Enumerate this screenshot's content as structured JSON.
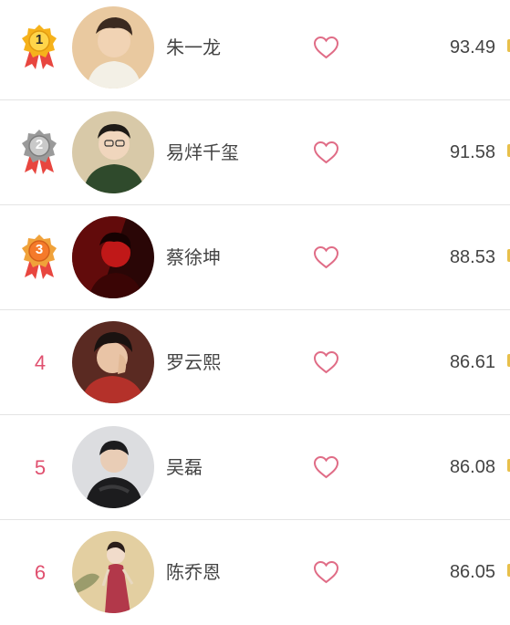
{
  "ranking": [
    {
      "rank": "1",
      "name": "朱一龙",
      "score": "93.49",
      "badge": "gold-medal-icon",
      "badge_color": "#f6b21b",
      "avatar_bg": "#e9c9a0",
      "avatar_accent": "#3b2a20"
    },
    {
      "rank": "2",
      "name": "易烊千玺",
      "score": "91.58",
      "badge": "silver-medal-icon",
      "badge_color": "#9a9a9a",
      "avatar_bg": "#d8c9a8",
      "avatar_accent": "#2f4a2c"
    },
    {
      "rank": "3",
      "name": "蔡徐坤",
      "score": "88.53",
      "badge": "bronze-medal-icon",
      "badge_color": "#f0a23a",
      "avatar_bg": "#2a0606",
      "avatar_accent": "#c01818"
    },
    {
      "rank": "4",
      "name": "罗云熙",
      "score": "86.61",
      "badge": "",
      "avatar_bg": "#5a2a22",
      "avatar_accent": "#b4312a"
    },
    {
      "rank": "5",
      "name": "吴磊",
      "score": "86.08",
      "badge": "",
      "avatar_bg": "#dcdde0",
      "avatar_accent": "#1c1c1e"
    },
    {
      "rank": "6",
      "name": "陈乔恩",
      "score": "86.05",
      "badge": "",
      "avatar_bg": "#e3cfa1",
      "avatar_accent": "#b2384a"
    }
  ],
  "colors": {
    "accent": "#e0506f",
    "heart": "#e06c86",
    "divider": "#e4e4e4",
    "text": "#444444",
    "ribbon": "#e8463f"
  },
  "icons": {
    "like": "heart-outline-icon"
  }
}
